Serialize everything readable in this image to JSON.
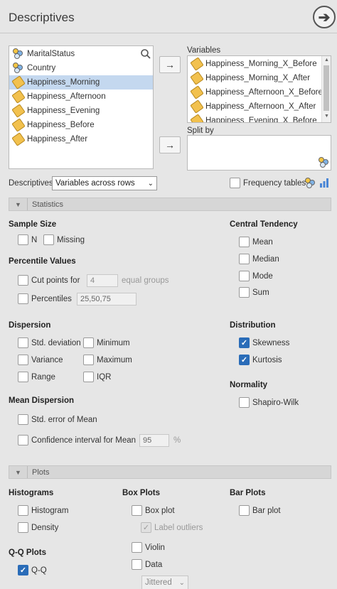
{
  "header": {
    "title": "Descriptives",
    "go_icon": "arrow-right-circle-icon"
  },
  "source_list": {
    "items": [
      {
        "label": "MaritalStatus",
        "type": "nominal"
      },
      {
        "label": "Country",
        "type": "nominal"
      },
      {
        "label": "Happiness_Morning",
        "type": "continuous",
        "selected": true
      },
      {
        "label": "Happiness_Afternoon",
        "type": "continuous"
      },
      {
        "label": "Happiness_Evening",
        "type": "continuous"
      },
      {
        "label": "Happiness_Before",
        "type": "continuous"
      },
      {
        "label": "Happiness_After",
        "type": "continuous"
      }
    ]
  },
  "variables_box": {
    "label": "Variables",
    "items": [
      "Happiness_Morning_X_Before",
      "Happiness_Morning_X_After",
      "Happiness_Afternoon_X_Before",
      "Happiness_Afternoon_X_After",
      "Happiness_Evening_X_Before"
    ]
  },
  "split_by": {
    "label": "Split by"
  },
  "move_button": "→",
  "descriptives_row": {
    "label": "Descriptives",
    "select_value": "Variables across rows",
    "freq_label": "Frequency tables"
  },
  "statistics_section": {
    "title": "Statistics",
    "sample_size": {
      "title": "Sample Size",
      "n": "N",
      "missing": "Missing"
    },
    "percentile": {
      "title": "Percentile Values",
      "cut_points": "Cut points for",
      "cut_value": "4",
      "equal_groups": "equal groups",
      "percentiles": "Percentiles",
      "percentiles_value": "25,50,75"
    },
    "dispersion": {
      "title": "Dispersion",
      "sd": "Std. deviation",
      "minimum": "Minimum",
      "variance": "Variance",
      "maximum": "Maximum",
      "range": "Range",
      "iqr": "IQR"
    },
    "mean_dispersion": {
      "title": "Mean Dispersion",
      "se": "Std. error of Mean",
      "ci": "Confidence interval for Mean",
      "ci_value": "95",
      "pct": "%"
    },
    "central": {
      "title": "Central Tendency",
      "mean": "Mean",
      "median": "Median",
      "mode": "Mode",
      "sum": "Sum"
    },
    "distribution": {
      "title": "Distribution",
      "skewness": "Skewness",
      "kurtosis": "Kurtosis"
    },
    "normality": {
      "title": "Normality",
      "shapiro": "Shapiro-Wilk"
    }
  },
  "plots_section": {
    "title": "Plots",
    "histograms": {
      "title": "Histograms",
      "histogram": "Histogram",
      "density": "Density"
    },
    "qq": {
      "title": "Q-Q Plots",
      "qq": "Q-Q"
    },
    "box": {
      "title": "Box Plots",
      "box_plot": "Box plot",
      "label_outliers": "Label outliers",
      "violin": "Violin",
      "data": "Data",
      "jitter": "Jittered"
    },
    "bar": {
      "title": "Bar Plots",
      "bar_plot": "Bar plot"
    }
  },
  "checked": {
    "skewness": true,
    "kurtosis": true,
    "qq": true,
    "label_outliers": true
  }
}
